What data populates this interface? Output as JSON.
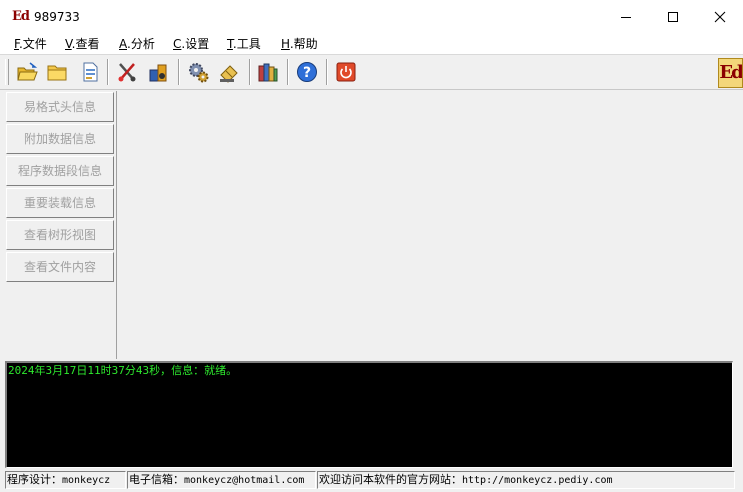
{
  "window": {
    "title": "989733",
    "logo_text": "Ed"
  },
  "menu": [
    {
      "accel": "F",
      "label": ".文件"
    },
    {
      "accel": "V",
      "label": ".查看"
    },
    {
      "accel": "A",
      "label": ".分析"
    },
    {
      "accel": "C",
      "label": ".设置"
    },
    {
      "accel": "T",
      "label": ".工具"
    },
    {
      "accel": "H",
      "label": ".帮助"
    }
  ],
  "toolbar": {
    "icons": [
      "open-folder-icon",
      "folder-icon",
      "document-icon",
      "tools-icon",
      "inspect-icon",
      "gear-icon",
      "plugin-icon",
      "books-icon",
      "help-icon",
      "power-icon"
    ],
    "brand_text": "Ed"
  },
  "sidebar": {
    "items": [
      {
        "label": "易格式头信息"
      },
      {
        "label": "附加数据信息"
      },
      {
        "label": "程序数据段信息"
      },
      {
        "label": "重要装载信息"
      },
      {
        "label": "查看树形视图"
      },
      {
        "label": "查看文件内容"
      }
    ]
  },
  "log": {
    "line": "2024年3月17日11时37分43秒，信息：就绪。"
  },
  "status": {
    "designer_label": "程序设计：",
    "designer": "monkeycz",
    "email_label": "电子信箱：",
    "email": "monkeycz@hotmail.com",
    "site_label": "欢迎访问本软件的官方网站：",
    "site": "http://monkeycz.pediy.com"
  },
  "colors": {
    "log_text": "#2ee82e",
    "log_bg": "#000000",
    "brand": "#8b0000"
  }
}
